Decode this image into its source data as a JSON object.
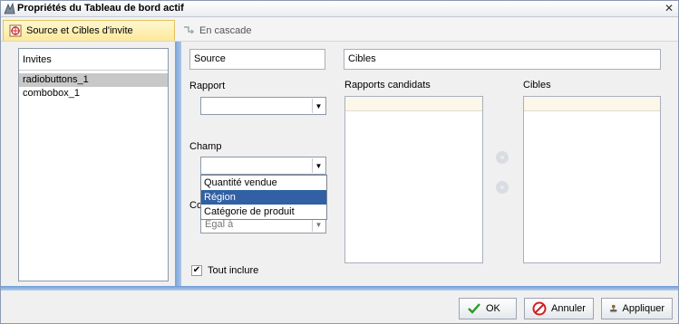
{
  "window": {
    "title": "Propriétés du Tableau de bord actif"
  },
  "tabs": [
    {
      "label": "Source et Cibles d'invite",
      "active": true
    },
    {
      "label": "En cascade",
      "active": false
    }
  ],
  "prompts": {
    "header": "Invites",
    "items": [
      "radiobuttons_1",
      "combobox_1"
    ],
    "selected_index": 0
  },
  "source": {
    "value": "Source",
    "rapport_label": "Rapport",
    "rapport_value": "",
    "champ_label": "Champ",
    "champ_value": "",
    "champ_options": [
      "Quantité vendue",
      "Région",
      "Catégorie de produit"
    ],
    "champ_selected": "Région",
    "condition_label_partial": "Co",
    "condition_value": "Egal à",
    "include_all_label": "Tout inclure",
    "include_all_checked": true
  },
  "targets": {
    "value": "Cibles",
    "candidates_label": "Rapports candidats",
    "targets_label": "Cibles"
  },
  "buttons": {
    "ok": "OK",
    "cancel": "Annuler",
    "apply": "Appliquer"
  },
  "colors": {
    "active_tab": "#fde99a",
    "accent_blue": "#3160a4",
    "side_bar": "#7aa3d6"
  }
}
